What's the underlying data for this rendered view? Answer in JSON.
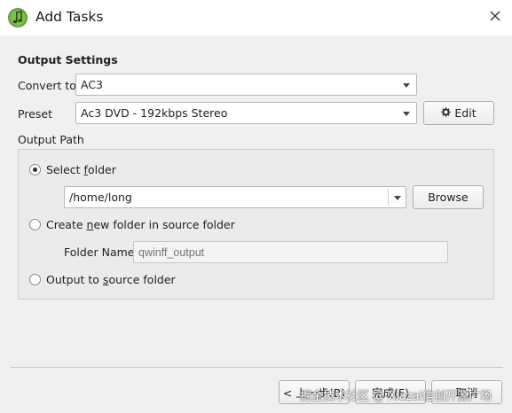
{
  "window": {
    "title": "Add Tasks"
  },
  "output_settings": {
    "heading": "Output Settings",
    "convert_to_label": "Convert to",
    "convert_to_value": "AC3",
    "preset_label": "Preset",
    "preset_value": "Ac3 DVD - 192kbps Stereo",
    "edit_button": "Edit"
  },
  "output_path": {
    "heading": "Output Path",
    "select_folder_pre": "Select ",
    "select_folder_u": "f",
    "select_folder_post": "older",
    "folder_value": "/home/long",
    "browse_button": "Browse",
    "create_new_pre": "Create ",
    "create_new_u": "n",
    "create_new_post": "ew folder in source folder",
    "folder_name_label": "Folder Name",
    "folder_name_placeholder": "qwinff_output",
    "output_source_pre": "Output to ",
    "output_source_u": "s",
    "output_source_post": "ource folder"
  },
  "footer": {
    "back_button": "< 上一步(B)",
    "finish_button": "完成(F)",
    "cancel_button": "取消",
    "watermark": "掘金技术社区 @ Xiazai信创开源广场"
  },
  "colors": {
    "window_bg": "#f0f0f0",
    "group_bg": "#ebebeb",
    "titlebar_bg": "#ffffff"
  },
  "icons": {
    "app": "music-note-icon",
    "close": "close-icon",
    "edit": "gear-icon"
  }
}
